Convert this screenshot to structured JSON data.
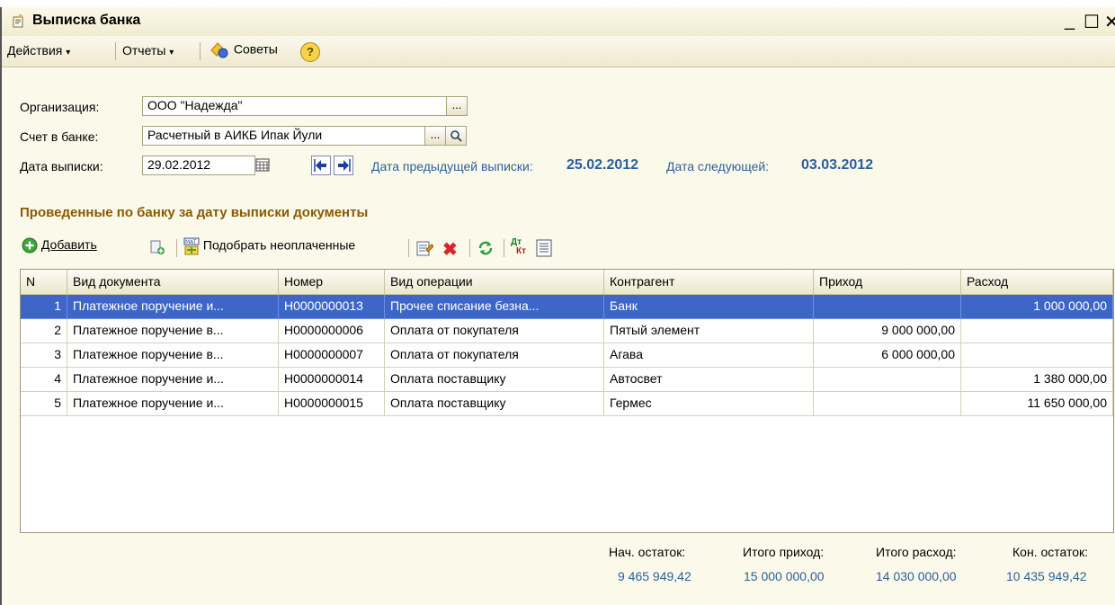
{
  "window": {
    "title": "Выписка банка",
    "controls": {
      "minimize": "_",
      "maximize": "☐",
      "close": "✕"
    }
  },
  "menu": {
    "actions": "Действия",
    "reports": "Отчеты",
    "tips": "Советы",
    "help": "?"
  },
  "form": {
    "org_label": "Организация:",
    "org_value": "ООО \"Надежда\"",
    "account_label": "Счет в банке:",
    "account_value": "Расчетный в АИКБ Ипак Йули",
    "date_label": "Дата выписки:",
    "date_value": "29.02.2012",
    "prev_label": "Дата предыдущей выписки:",
    "prev_value": "25.02.2012",
    "next_label": "Дата следующей:",
    "next_value": "03.03.2012",
    "ellipsis": "...",
    "search_icon": "magnifier-icon"
  },
  "section_title": "Проведенные по банку за дату выписки документы",
  "table_toolbar": {
    "add_label": "Добавить",
    "select_unpaid_label": "Подобрать неоплаченные",
    "icons": [
      "add-icon",
      "copy-icon",
      "select-unpaid-icon",
      "edit-icon",
      "delete-icon",
      "refresh-icon",
      "dt-kt-icon",
      "list-icon"
    ]
  },
  "table": {
    "columns": [
      "N",
      "Вид документа",
      "Номер",
      "Вид операции",
      "Контрагент",
      "Приход",
      "Расход"
    ],
    "rows": [
      {
        "n": "1",
        "doc_type": "Платежное поручение и...",
        "number": "Н0000000013",
        "operation": "Прочее списание безна...",
        "counterparty": "Банк",
        "income": "",
        "expense": "1 000 000,00",
        "selected": true
      },
      {
        "n": "2",
        "doc_type": "Платежное поручение в...",
        "number": "Н0000000006",
        "operation": "Оплата от покупателя",
        "counterparty": "Пятый элемент",
        "income": "9 000 000,00",
        "expense": "",
        "selected": false
      },
      {
        "n": "3",
        "doc_type": "Платежное поручение в...",
        "number": "Н0000000007",
        "operation": "Оплата от покупателя",
        "counterparty": "Агава",
        "income": "6 000 000,00",
        "expense": "",
        "selected": false
      },
      {
        "n": "4",
        "doc_type": "Платежное поручение и...",
        "number": "Н0000000014",
        "operation": "Оплата поставщику",
        "counterparty": "Автосвет",
        "income": "",
        "expense": "1 380 000,00",
        "selected": false
      },
      {
        "n": "5",
        "doc_type": "Платежное поручение и...",
        "number": "Н0000000015",
        "operation": "Оплата поставщику",
        "counterparty": "Гермес",
        "income": "",
        "expense": "11 650 000,00",
        "selected": false
      }
    ]
  },
  "totals": {
    "start_label": "Нач. остаток:",
    "start_value": "9 465 949,42",
    "income_label": "Итого приход:",
    "income_value": "15 000 000,00",
    "expense_label": "Итого расход:",
    "expense_value": "14 030 000,00",
    "end_label": "Кон. остаток:",
    "end_value": "10 435 949,42"
  },
  "colors": {
    "window_bg": "#fbf9e9",
    "selection": "#3e66c8",
    "link_blue": "#2d5e9c",
    "section_title": "#8b5a00",
    "delete_red": "#d9262e"
  }
}
